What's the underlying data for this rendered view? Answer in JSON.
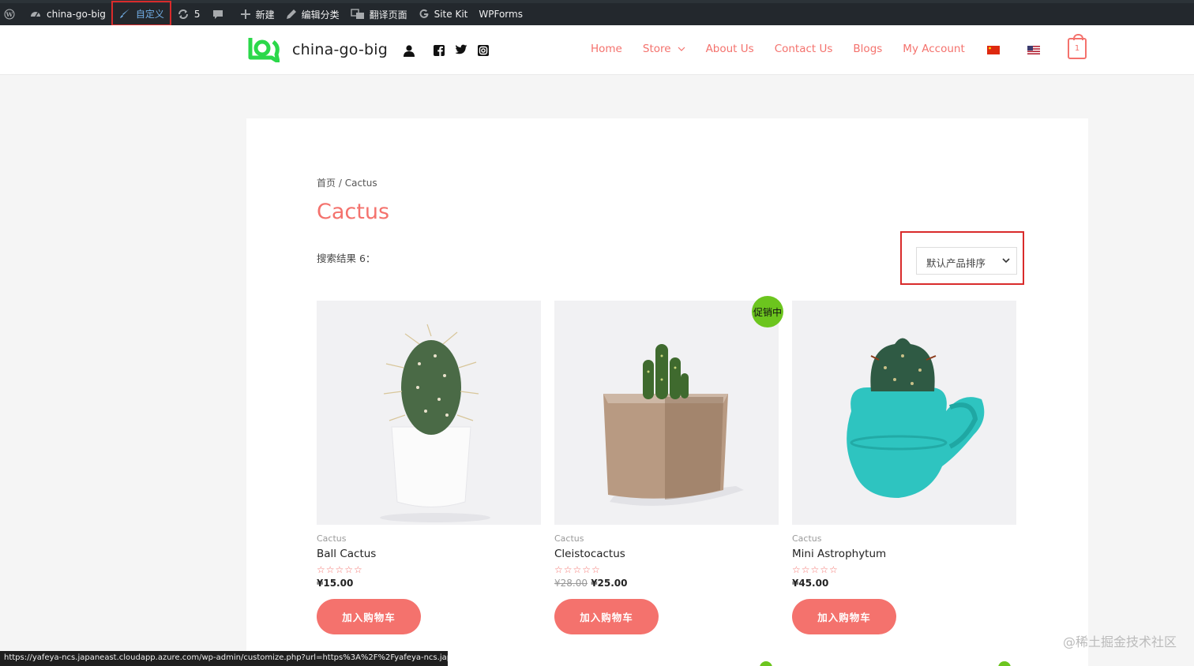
{
  "adminbar": {
    "site": "china-go-big",
    "customize": "自定义",
    "updates": "5",
    "new": "新建",
    "edit_category": "编辑分类",
    "translate": "翻译页面",
    "sitekit": "Site Kit",
    "wpforms": "WPForms"
  },
  "header": {
    "site_title": "china-go-big",
    "nav": [
      "Home",
      "Store",
      "About Us",
      "Contact Us",
      "Blogs",
      "My Account"
    ],
    "cart_count": "1",
    "brand_color": "#f4726d"
  },
  "main": {
    "breadcrumb_home": "首页",
    "breadcrumb_sep": "/",
    "breadcrumb_current": "Cactus",
    "title": "Cactus",
    "result_count": "搜索结果 6：",
    "sort_selected": "默认产品排序"
  },
  "products": [
    {
      "category": "Cactus",
      "name": "Ball Cactus",
      "stars": "☆☆☆☆☆",
      "old_price": "",
      "price": "¥15.00",
      "button": "加入购物车"
    },
    {
      "category": "Cactus",
      "name": "Cleistocactus",
      "stars": "☆☆☆☆☆",
      "old_price": "¥28.00",
      "price": "¥25.00",
      "button": "加入购物车",
      "badge": "促销中"
    },
    {
      "category": "Cactus",
      "name": "Mini Astrophytum",
      "stars": "☆☆☆☆☆",
      "old_price": "",
      "price": "¥45.00",
      "button": "加入购物车"
    }
  ],
  "statusbar": "https://yafeya-ncs.japaneast.cloudapp.azure.com/wp-admin/customize.php?url=https%3A%2F%2Fyafeya-ncs.japane...",
  "watermark": "@稀土掘金技术社区"
}
